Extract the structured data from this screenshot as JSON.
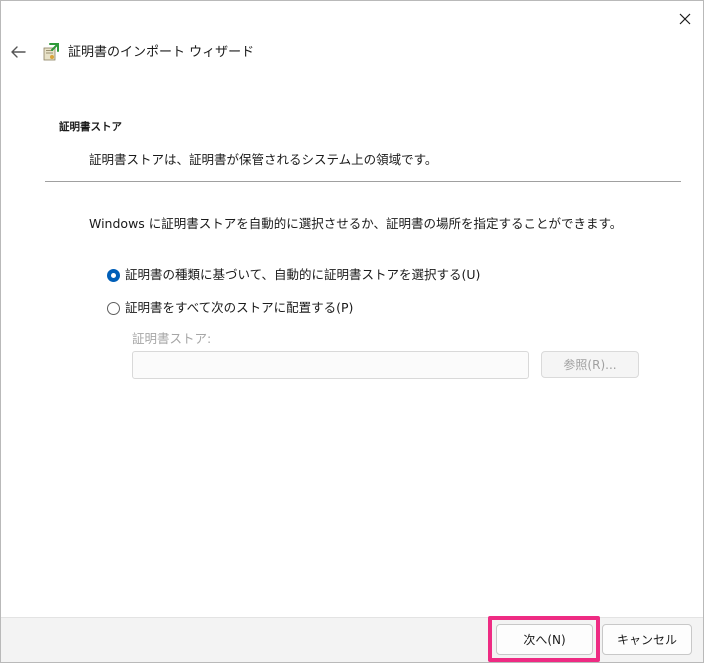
{
  "window": {
    "title": "証明書のインポート ウィザード",
    "close_icon": "close-icon",
    "back_icon": "arrow-left-icon",
    "wizard_icon": "certificate-import-icon"
  },
  "section": {
    "heading": "証明書ストア",
    "description": "証明書ストアは、証明書が保管されるシステム上の領域です。"
  },
  "content": {
    "intro": "Windows に証明書ストアを自動的に選択させるか、証明書の場所を指定することができます。",
    "options": [
      {
        "label": "証明書の種類に基づいて、自動的に証明書ストアを選択する(U)",
        "checked": true
      },
      {
        "label": "証明書をすべて次のストアに配置する(P)",
        "checked": false
      }
    ],
    "store_field_label": "証明書ストア:",
    "store_field_value": "",
    "browse_label": "参照(R)..."
  },
  "footer": {
    "next_label": "次へ(N)",
    "cancel_label": "キャンセル"
  },
  "colors": {
    "accent": "#005fb8",
    "highlight": "#ee2b83",
    "footer_bg": "#f3f3f3"
  }
}
